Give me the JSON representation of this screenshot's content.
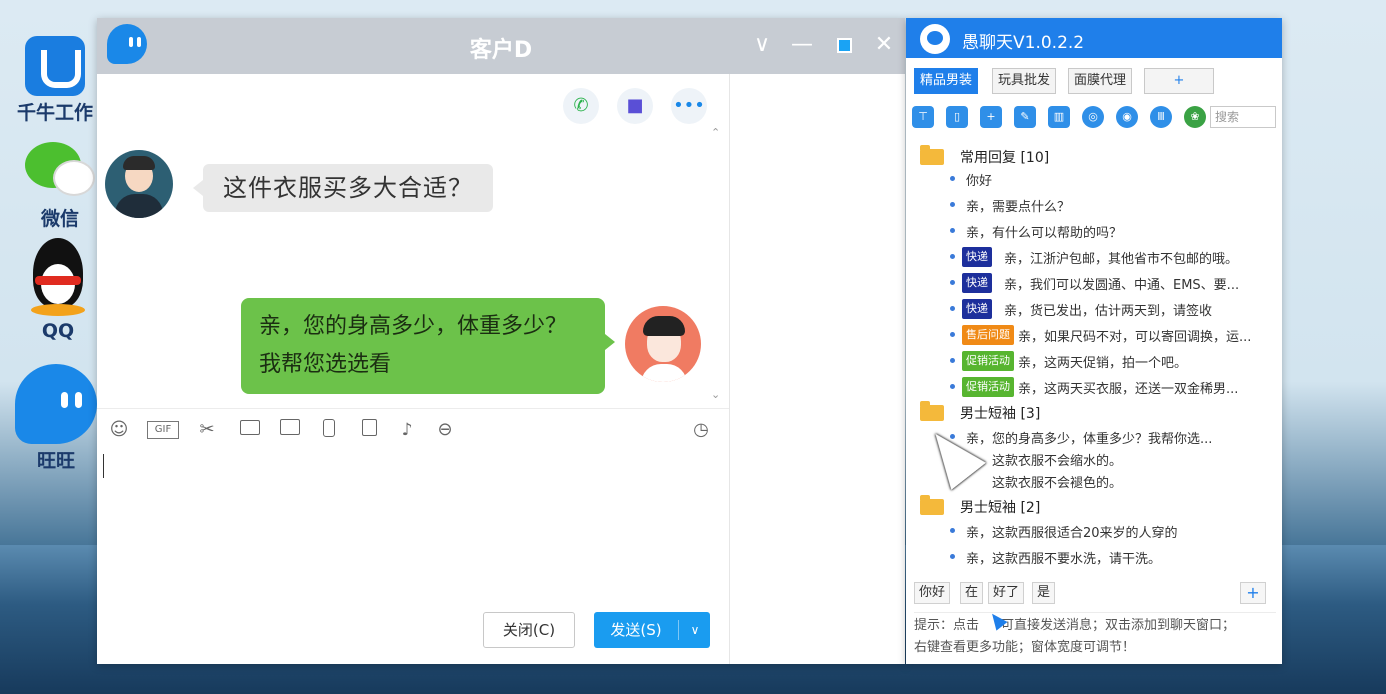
{
  "desktop": {
    "icons": [
      {
        "label": "千牛工作"
      },
      {
        "label": "微信"
      },
      {
        "label": "QQ"
      },
      {
        "label": "旺旺"
      }
    ]
  },
  "chat_window": {
    "title": "客户D",
    "controls": {
      "collapse": "∨",
      "minimize": "—",
      "close": "✕"
    },
    "messages": [
      {
        "from": "customer",
        "text": "这件衣服买多大合适？"
      },
      {
        "from": "seller",
        "text": "亲，您的身高多少，体重多少？我帮您选选看"
      }
    ],
    "toolbar_icons": [
      "emoji-icon",
      "gif-icon",
      "scissors-icon",
      "folder-icon",
      "image-icon",
      "phone-shake-icon",
      "calendar-icon",
      "music-icon",
      "more-icon",
      "history-clock-icon"
    ],
    "gif_label": "GIF",
    "buttons": {
      "close": "关闭(C)",
      "send": "发送(S)"
    }
  },
  "plugin": {
    "title": "愚聊天V1.0.2.2",
    "tabs": [
      "精品男装",
      "玩具批发",
      "面膜代理",
      "+"
    ],
    "search_placeholder": "搜索",
    "groups": [
      {
        "name": "常用回复 [10]",
        "items": [
          {
            "tag": "",
            "tag_color": "",
            "text": "你好"
          },
          {
            "tag": "",
            "tag_color": "",
            "text": "亲，需要点什么？"
          },
          {
            "tag": "",
            "tag_color": "",
            "text": "亲，有什么可以帮助的吗？"
          },
          {
            "tag": "快递",
            "tag_color": "blue",
            "text": "亲，江浙沪包邮，其他省市不包邮的哦。"
          },
          {
            "tag": "快递",
            "tag_color": "blue",
            "text": "亲，我们可以发圆通、中通、EMS、要..."
          },
          {
            "tag": "快递",
            "tag_color": "blue",
            "text": "亲，货已发出，估计两天到，请签收"
          },
          {
            "tag": "售后问题",
            "tag_color": "orange",
            "text": "亲，如果尺码不对，可以寄回调换，运..."
          },
          {
            "tag": "促销活动",
            "tag_color": "green",
            "text": "亲，这两天促销，拍一个吧。"
          },
          {
            "tag": "促销活动",
            "tag_color": "green",
            "text": "亲，这两天买衣服，还送一双金稀男..."
          }
        ]
      },
      {
        "name": "男士短袖 [3]",
        "items": [
          {
            "tag": "",
            "tag_color": "",
            "text": "亲，您的身高多少，体重多少？我帮你选..."
          },
          {
            "tag": "",
            "tag_color": "",
            "text": "这款衣服不会缩水的。"
          },
          {
            "tag": "",
            "tag_color": "",
            "text": "这款衣服不会褪色的。"
          }
        ]
      },
      {
        "name": "男士短袖 [2]",
        "items": [
          {
            "tag": "",
            "tag_color": "",
            "text": "亲，这款西服很适合20来岁的人穿的"
          },
          {
            "tag": "",
            "tag_color": "",
            "text": "亲，这款西服不要水洗，请干洗。"
          }
        ]
      }
    ],
    "quick_replies": [
      "你好",
      "在",
      "好了",
      "是"
    ],
    "quick_add": "+",
    "tip_line1": "提示：点击",
    "tip_line1_rest": "可直接发送消息；双击添加到聊天窗口；",
    "tip_line2": "右键查看更多功能；窗体宽度可调节！"
  },
  "colors": {
    "accent": "#1f7fea",
    "send_button": "#1a9cf0",
    "seller_bubble": "#6cc24a",
    "customer_bubble": "#e9e9e9",
    "tag_blue": "#1d2f9c",
    "tag_orange": "#f08a16",
    "tag_green": "#57b530"
  }
}
